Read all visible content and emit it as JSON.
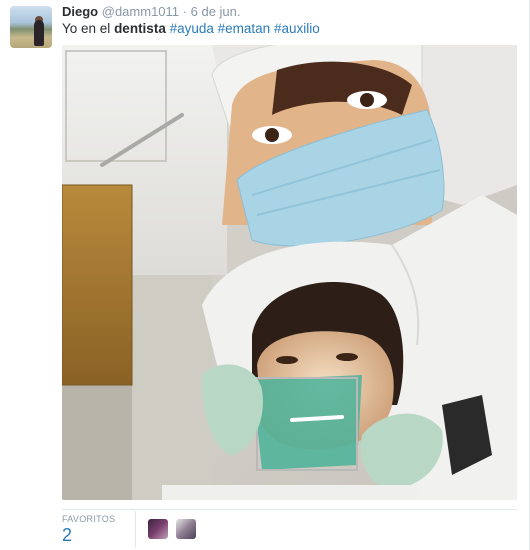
{
  "tweet": {
    "fullname": "Diego",
    "username": "@damm1011",
    "separator": "·",
    "time": "6 de jun.",
    "text_before": "Yo en el ",
    "text_strong": "dentista",
    "hashtags": [
      "#ayuda",
      "#ematan",
      "#auxilio"
    ]
  },
  "stats": {
    "favorites_label": "FAVORITOS",
    "favorites_count": "2"
  },
  "colors": {
    "link": "#2b7bb9",
    "muted": "#8899a6",
    "text": "#292f33",
    "divider": "#e1e8ed"
  }
}
